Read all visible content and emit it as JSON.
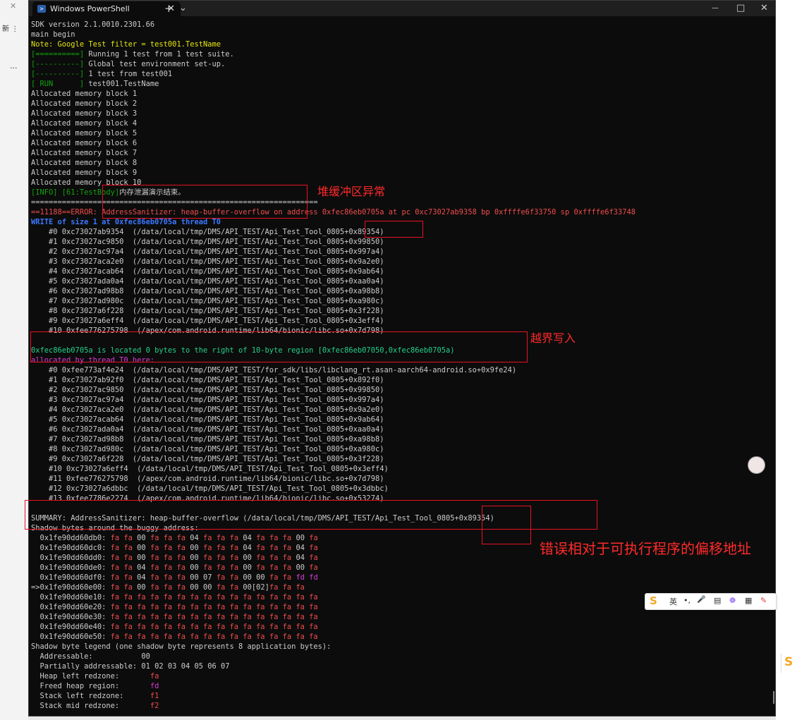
{
  "window": {
    "tab_title": "Windows PowerShell",
    "tab_close": "✕",
    "new_tab": "+",
    "tab_dropdown": "⌄",
    "minimize": "—",
    "maximize": "□",
    "close": "✕"
  },
  "sidebar": {
    "chars": "⁝",
    "badge": "新 ⋮",
    "more": "···"
  },
  "terminal": {
    "lines": [
      [
        {
          "t": "SDK version 2.1.0010.2301.66",
          "c": ""
        }
      ],
      [
        {
          "t": "main begin",
          "c": ""
        }
      ],
      [
        {
          "t": "Note: Google Test filter = test001.TestName",
          "c": "yellow"
        }
      ],
      [
        {
          "t": "[==========]",
          "c": "green"
        },
        {
          "t": " Running 1 test from 1 test suite.",
          "c": ""
        }
      ],
      [
        {
          "t": "[----------]",
          "c": "green"
        },
        {
          "t": " Global test environment set-up.",
          "c": ""
        }
      ],
      [
        {
          "t": "[----------]",
          "c": "green"
        },
        {
          "t": " 1 test from test001",
          "c": ""
        }
      ],
      [
        {
          "t": "[ RUN      ]",
          "c": "green"
        },
        {
          "t": " test001.TestName",
          "c": ""
        }
      ],
      [
        {
          "t": "Allocated memory block 1",
          "c": ""
        }
      ],
      [
        {
          "t": "Allocated memory block 2",
          "c": ""
        }
      ],
      [
        {
          "t": "Allocated memory block 3",
          "c": ""
        }
      ],
      [
        {
          "t": "Allocated memory block 4",
          "c": ""
        }
      ],
      [
        {
          "t": "Allocated memory block 5",
          "c": ""
        }
      ],
      [
        {
          "t": "Allocated memory block 6",
          "c": ""
        }
      ],
      [
        {
          "t": "Allocated memory block 7",
          "c": ""
        }
      ],
      [
        {
          "t": "Allocated memory block 8",
          "c": ""
        }
      ],
      [
        {
          "t": "Allocated memory block 9",
          "c": ""
        }
      ],
      [
        {
          "t": "Allocated memory block 10",
          "c": ""
        }
      ],
      [
        {
          "t": "[INFO] [61:TestBody]",
          "c": "green"
        },
        {
          "t": "内存泄漏演示结束。",
          "c": ""
        }
      ],
      [
        {
          "t": "=================================================================",
          "c": ""
        }
      ],
      [
        {
          "t": "==11188==ERROR: AddressSanitizer: heap-buffer-overflow on address 0xfec86eb0705a at pc 0xc73027ab9358 bp 0xffffe6f33750 sp 0xffffe6f33748",
          "c": "red"
        }
      ],
      [
        {
          "t": "WRITE of size 1 at 0xfec86eb0705a thread T0",
          "c": "blue"
        }
      ],
      [
        {
          "t": "    #0 0xc73027ab9354  (/data/local/tmp/DMS/API_TEST/Api_Test_Tool_0805+0x89354)",
          "c": ""
        }
      ],
      [
        {
          "t": "    #1 0xc73027ac9850  (/data/local/tmp/DMS/API_TEST/Api_Test_Tool_0805+0x99850)",
          "c": ""
        }
      ],
      [
        {
          "t": "    #2 0xc73027ac97a4  (/data/local/tmp/DMS/API_TEST/Api_Test_Tool_0805+0x997a4)",
          "c": ""
        }
      ],
      [
        {
          "t": "    #3 0xc73027aca2e0  (/data/local/tmp/DMS/API_TEST/Api_Test_Tool_0805+0x9a2e0)",
          "c": ""
        }
      ],
      [
        {
          "t": "    #4 0xc73027acab64  (/data/local/tmp/DMS/API_TEST/Api_Test_Tool_0805+0x9ab64)",
          "c": ""
        }
      ],
      [
        {
          "t": "    #5 0xc73027ada0a4  (/data/local/tmp/DMS/API_TEST/Api_Test_Tool_0805+0xaa0a4)",
          "c": ""
        }
      ],
      [
        {
          "t": "    #6 0xc73027ad98b8  (/data/local/tmp/DMS/API_TEST/Api_Test_Tool_0805+0xa98b8)",
          "c": ""
        }
      ],
      [
        {
          "t": "    #7 0xc73027ad980c  (/data/local/tmp/DMS/API_TEST/Api_Test_Tool_0805+0xa980c)",
          "c": ""
        }
      ],
      [
        {
          "t": "    #8 0xc73027a6f228  (/data/local/tmp/DMS/API_TEST/Api_Test_Tool_0805+0x3f228)",
          "c": ""
        }
      ],
      [
        {
          "t": "    #9 0xc73027a6eff4  (/data/local/tmp/DMS/API_TEST/Api_Test_Tool_0805+0x3eff4)",
          "c": ""
        }
      ],
      [
        {
          "t": "    #10 0xfee776275798  (/apex/com.android.runtime/lib64/bionic/libc.so+0x7d798)",
          "c": ""
        }
      ],
      [
        {
          "t": "",
          "c": ""
        }
      ],
      [
        {
          "t": "0xfec86eb0705a is located 0 bytes to the right of 10-byte region [0xfec86eb07050,0xfec86eb0705a)",
          "c": "bgreen"
        }
      ],
      [
        {
          "t": "allocated by thread T0 here:",
          "c": "magenta"
        }
      ],
      [
        {
          "t": "    #0 0xfee773af4e24  (/data/local/tmp/DMS/API_TEST/for_sdk/libs/libclang_rt.asan-aarch64-android.so+0x9fe24)",
          "c": ""
        }
      ],
      [
        {
          "t": "    #1 0xc73027ab92f0  (/data/local/tmp/DMS/API_TEST/Api_Test_Tool_0805+0x892f0)",
          "c": ""
        }
      ],
      [
        {
          "t": "    #2 0xc73027ac9850  (/data/local/tmp/DMS/API_TEST/Api_Test_Tool_0805+0x99850)",
          "c": ""
        }
      ],
      [
        {
          "t": "    #3 0xc73027ac97a4  (/data/local/tmp/DMS/API_TEST/Api_Test_Tool_0805+0x997a4)",
          "c": ""
        }
      ],
      [
        {
          "t": "    #4 0xc73027aca2e0  (/data/local/tmp/DMS/API_TEST/Api_Test_Tool_0805+0x9a2e0)",
          "c": ""
        }
      ],
      [
        {
          "t": "    #5 0xc73027acab64  (/data/local/tmp/DMS/API_TEST/Api_Test_Tool_0805+0x9ab64)",
          "c": ""
        }
      ],
      [
        {
          "t": "    #6 0xc73027ada0a4  (/data/local/tmp/DMS/API_TEST/Api_Test_Tool_0805+0xaa0a4)",
          "c": ""
        }
      ],
      [
        {
          "t": "    #7 0xc73027ad98b8  (/data/local/tmp/DMS/API_TEST/Api_Test_Tool_0805+0xa98b8)",
          "c": ""
        }
      ],
      [
        {
          "t": "    #8 0xc73027ad980c  (/data/local/tmp/DMS/API_TEST/Api_Test_Tool_0805+0xa980c)",
          "c": ""
        }
      ],
      [
        {
          "t": "    #9 0xc73027a6f228  (/data/local/tmp/DMS/API_TEST/Api_Test_Tool_0805+0x3f228)",
          "c": ""
        }
      ],
      [
        {
          "t": "    #10 0xc73027a6eff4  (/data/local/tmp/DMS/API_TEST/Api_Test_Tool_0805+0x3eff4)",
          "c": ""
        }
      ],
      [
        {
          "t": "    #11 0xfee776275798  (/apex/com.android.runtime/lib64/bionic/libc.so+0x7d798)",
          "c": ""
        }
      ],
      [
        {
          "t": "    #12 0xc73027a6dbbc  (/data/local/tmp/DMS/API_TEST/Api_Test_Tool_0805+0x3dbbc)",
          "c": ""
        }
      ],
      [
        {
          "t": "    #13 0xfee7786e2274  (/apex/com.android.runtime/lib64/bionic/libc.so+0x53274)",
          "c": ""
        }
      ],
      [
        {
          "t": "",
          "c": ""
        }
      ],
      [
        {
          "t": "SUMMARY: AddressSanitizer: heap-buffer-overflow (/data/local/tmp/DMS/API_TEST/Api_Test_Tool_0805+0x89354)",
          "c": ""
        }
      ],
      [
        {
          "t": "Shadow bytes around the buggy address:",
          "c": ""
        }
      ],
      [
        {
          "t": "  0x1fe90dd60db0: ",
          "c": ""
        },
        {
          "t": "fa fa ",
          "c": "red"
        },
        {
          "t": "00 ",
          "c": ""
        },
        {
          "t": "fa fa fa ",
          "c": "red"
        },
        {
          "t": "04 ",
          "c": ""
        },
        {
          "t": "fa fa fa ",
          "c": "red"
        },
        {
          "t": "04 ",
          "c": ""
        },
        {
          "t": "fa fa fa ",
          "c": "red"
        },
        {
          "t": "00 ",
          "c": ""
        },
        {
          "t": "fa",
          "c": "red"
        }
      ],
      [
        {
          "t": "  0x1fe90dd60dc0: ",
          "c": ""
        },
        {
          "t": "fa fa ",
          "c": "red"
        },
        {
          "t": "00 ",
          "c": ""
        },
        {
          "t": "fa fa fa ",
          "c": "red"
        },
        {
          "t": "00 ",
          "c": ""
        },
        {
          "t": "fa fa fa ",
          "c": "red"
        },
        {
          "t": "04 ",
          "c": ""
        },
        {
          "t": "fa fa fa ",
          "c": "red"
        },
        {
          "t": "04 ",
          "c": ""
        },
        {
          "t": "fa",
          "c": "red"
        }
      ],
      [
        {
          "t": "  0x1fe90dd60dd0: ",
          "c": ""
        },
        {
          "t": "fa fa ",
          "c": "red"
        },
        {
          "t": "00 ",
          "c": ""
        },
        {
          "t": "fa fa fa ",
          "c": "red"
        },
        {
          "t": "00 ",
          "c": ""
        },
        {
          "t": "fa fa fa ",
          "c": "red"
        },
        {
          "t": "00 ",
          "c": ""
        },
        {
          "t": "fa fa fa ",
          "c": "red"
        },
        {
          "t": "04 ",
          "c": ""
        },
        {
          "t": "fa",
          "c": "red"
        }
      ],
      [
        {
          "t": "  0x1fe90dd60de0: ",
          "c": ""
        },
        {
          "t": "fa fa ",
          "c": "red"
        },
        {
          "t": "04 ",
          "c": ""
        },
        {
          "t": "fa fa fa ",
          "c": "red"
        },
        {
          "t": "00 ",
          "c": ""
        },
        {
          "t": "fa fa fa ",
          "c": "red"
        },
        {
          "t": "00 ",
          "c": ""
        },
        {
          "t": "fa fa fa ",
          "c": "red"
        },
        {
          "t": "00 ",
          "c": ""
        },
        {
          "t": "fa",
          "c": "red"
        }
      ],
      [
        {
          "t": "  0x1fe90dd60df0: ",
          "c": ""
        },
        {
          "t": "fa fa ",
          "c": "red"
        },
        {
          "t": "04 ",
          "c": ""
        },
        {
          "t": "fa fa fa ",
          "c": "red"
        },
        {
          "t": "00 07 ",
          "c": ""
        },
        {
          "t": "fa fa ",
          "c": "red"
        },
        {
          "t": "00 00 ",
          "c": ""
        },
        {
          "t": "fa fa ",
          "c": "red"
        },
        {
          "t": "fd fd",
          "c": "magenta"
        }
      ],
      [
        {
          "t": "=>0x1fe90dd60e00: ",
          "c": ""
        },
        {
          "t": "fa fa ",
          "c": "red"
        },
        {
          "t": "00 ",
          "c": ""
        },
        {
          "t": "fa fa fa ",
          "c": "red"
        },
        {
          "t": "00 00 ",
          "c": ""
        },
        {
          "t": "fa fa ",
          "c": "red"
        },
        {
          "t": "00[02]",
          "c": ""
        },
        {
          "t": "fa fa fa",
          "c": "red"
        }
      ],
      [
        {
          "t": "  0x1fe90dd60e10: ",
          "c": ""
        },
        {
          "t": "fa fa fa fa fa fa fa fa fa fa fa fa fa fa fa fa",
          "c": "red"
        }
      ],
      [
        {
          "t": "  0x1fe90dd60e20: ",
          "c": ""
        },
        {
          "t": "fa fa fa fa fa fa fa fa fa fa fa fa fa fa fa fa",
          "c": "red"
        }
      ],
      [
        {
          "t": "  0x1fe90dd60e30: ",
          "c": ""
        },
        {
          "t": "fa fa fa fa fa fa fa fa fa fa fa fa fa fa fa fa",
          "c": "red"
        }
      ],
      [
        {
          "t": "  0x1fe90dd60e40: ",
          "c": ""
        },
        {
          "t": "fa fa fa fa fa fa fa fa fa fa fa fa fa fa fa fa",
          "c": "red"
        }
      ],
      [
        {
          "t": "  0x1fe90dd60e50: ",
          "c": ""
        },
        {
          "t": "fa fa fa fa fa fa fa fa fa fa fa fa fa fa fa fa",
          "c": "red"
        }
      ],
      [
        {
          "t": "Shadow byte legend (one shadow byte represents 8 application bytes):",
          "c": ""
        }
      ],
      [
        {
          "t": "  Addressable:           00",
          "c": ""
        }
      ],
      [
        {
          "t": "  Partially addressable: 01 02 03 04 05 06 07",
          "c": ""
        }
      ],
      [
        {
          "t": "  Heap left redzone:       ",
          "c": ""
        },
        {
          "t": "fa",
          "c": "red"
        }
      ],
      [
        {
          "t": "  Freed heap region:       ",
          "c": ""
        },
        {
          "t": "fd",
          "c": "magenta"
        }
      ],
      [
        {
          "t": "  Stack left redzone:      ",
          "c": ""
        },
        {
          "t": "f1",
          "c": "red"
        }
      ],
      [
        {
          "t": "  Stack mid redzone:       ",
          "c": ""
        },
        {
          "t": "f2",
          "c": "red"
        }
      ]
    ]
  },
  "annotations": {
    "heap_overflow": "堆缓冲区异常",
    "out_of_bounds": "越界写入",
    "offset_address": "错误相对于可执行程序的偏移地址"
  },
  "ime": {
    "logo": "S",
    "lang": "英",
    "punct": "•,",
    "mic": "🎤",
    "keyboard": "▤",
    "skin": "❁",
    "grid": "▦",
    "tool": "✎"
  },
  "ime_side": {
    "logo": "S"
  },
  "colors": {
    "terminal_bg": "#0c0c0c",
    "annotation_red": "#e81123",
    "ime_logo": "#f5a623"
  }
}
